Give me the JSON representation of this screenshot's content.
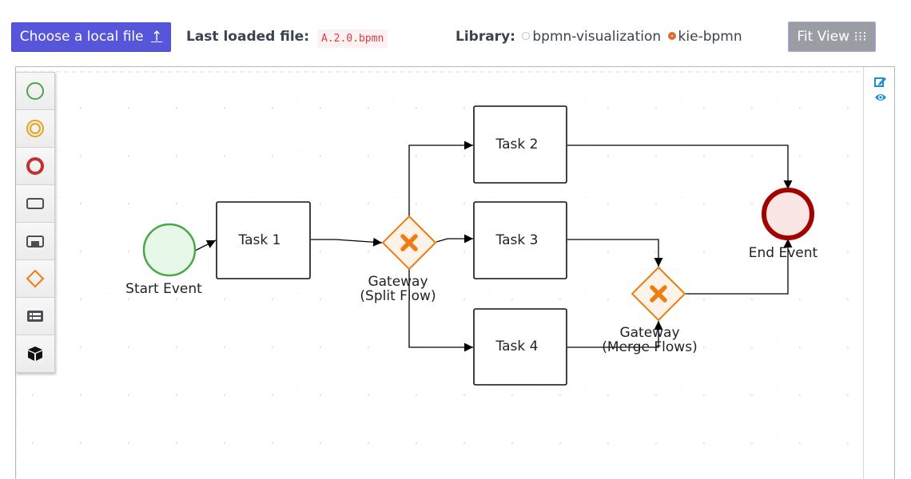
{
  "toolbar": {
    "choose_file_label": "Choose a local file",
    "choose_file_icon": "upload-arrow-icon",
    "upload_glyph": "↑",
    "last_loaded_label": "Last loaded file:",
    "last_loaded_file": "A.2.0.bpmn",
    "library_label": "Library:",
    "library_options": [
      {
        "label": "bpmn-visualization",
        "selected": false
      },
      {
        "label": "kie-bpmn",
        "selected": true
      }
    ],
    "fit_view_label": "Fit View",
    "fit_view_glyph": "⁝⁝⁝"
  },
  "palette": {
    "items": [
      {
        "name": "start-event",
        "icon": "start-event-icon",
        "color": "#4ba54b"
      },
      {
        "name": "intermediate-event",
        "icon": "intermediate-event-icon",
        "color": "#e6a21a"
      },
      {
        "name": "end-event",
        "icon": "end-event-icon",
        "color": "#c43030"
      },
      {
        "name": "task",
        "icon": "task-icon",
        "color": "#4b4f55"
      },
      {
        "name": "subprocess",
        "icon": "subprocess-icon",
        "color": "#4b4f55"
      },
      {
        "name": "gateway",
        "icon": "gateway-icon",
        "color": "#ef7d14"
      },
      {
        "name": "lane",
        "icon": "lane-icon",
        "color": "#4b4f55"
      },
      {
        "name": "custom",
        "icon": "cube-icon",
        "color": "#111111"
      }
    ]
  },
  "right_panel": {
    "icons": [
      "edit-icon",
      "eye-icon"
    ],
    "accent": "#1c8fd6"
  },
  "diagram": {
    "nodes": [
      {
        "id": "start",
        "type": "startEvent",
        "label": [
          "Start Event"
        ]
      },
      {
        "id": "task1",
        "type": "task",
        "label": [
          "Task 1"
        ]
      },
      {
        "id": "split",
        "type": "exclusiveGateway",
        "label": [
          "Gateway",
          "(Split Flow)"
        ]
      },
      {
        "id": "task2",
        "type": "task",
        "label": [
          "Task 2"
        ]
      },
      {
        "id": "task3",
        "type": "task",
        "label": [
          "Task 3"
        ]
      },
      {
        "id": "task4",
        "type": "task",
        "label": [
          "Task 4"
        ]
      },
      {
        "id": "merge",
        "type": "exclusiveGateway",
        "label": [
          "Gateway",
          "(Merge Flows)"
        ]
      },
      {
        "id": "end",
        "type": "endEvent",
        "label": [
          "End Event"
        ]
      }
    ],
    "edges": [
      {
        "from": "start",
        "to": "task1"
      },
      {
        "from": "task1",
        "to": "split"
      },
      {
        "from": "split",
        "to": "task2"
      },
      {
        "from": "split",
        "to": "task3"
      },
      {
        "from": "split",
        "to": "task4"
      },
      {
        "from": "task2",
        "to": "end"
      },
      {
        "from": "task3",
        "to": "merge"
      },
      {
        "from": "task4",
        "to": "merge"
      },
      {
        "from": "merge",
        "to": "end"
      }
    ],
    "colors": {
      "start_stroke": "#4ba54b",
      "start_fill": "#e8f8e8",
      "end_stroke": "#a30000",
      "end_fill": "#fbe6e6",
      "gateway_stroke": "#ef7d14",
      "gateway_fill": "#fef3e8",
      "task_stroke": "#111111",
      "task_fill": "#ffffff"
    }
  }
}
